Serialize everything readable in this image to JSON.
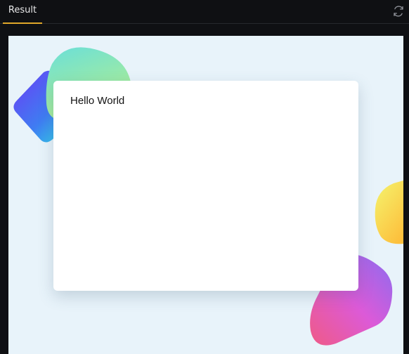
{
  "tabs": [
    {
      "label": "Result"
    }
  ],
  "toolbar": {
    "refresh_icon": "refresh-icon"
  },
  "card": {
    "text": "Hello World"
  },
  "colors": {
    "tab_accent": "#e0a72a",
    "pane_background": "#e8f3fa",
    "card_background": "#ffffff"
  }
}
